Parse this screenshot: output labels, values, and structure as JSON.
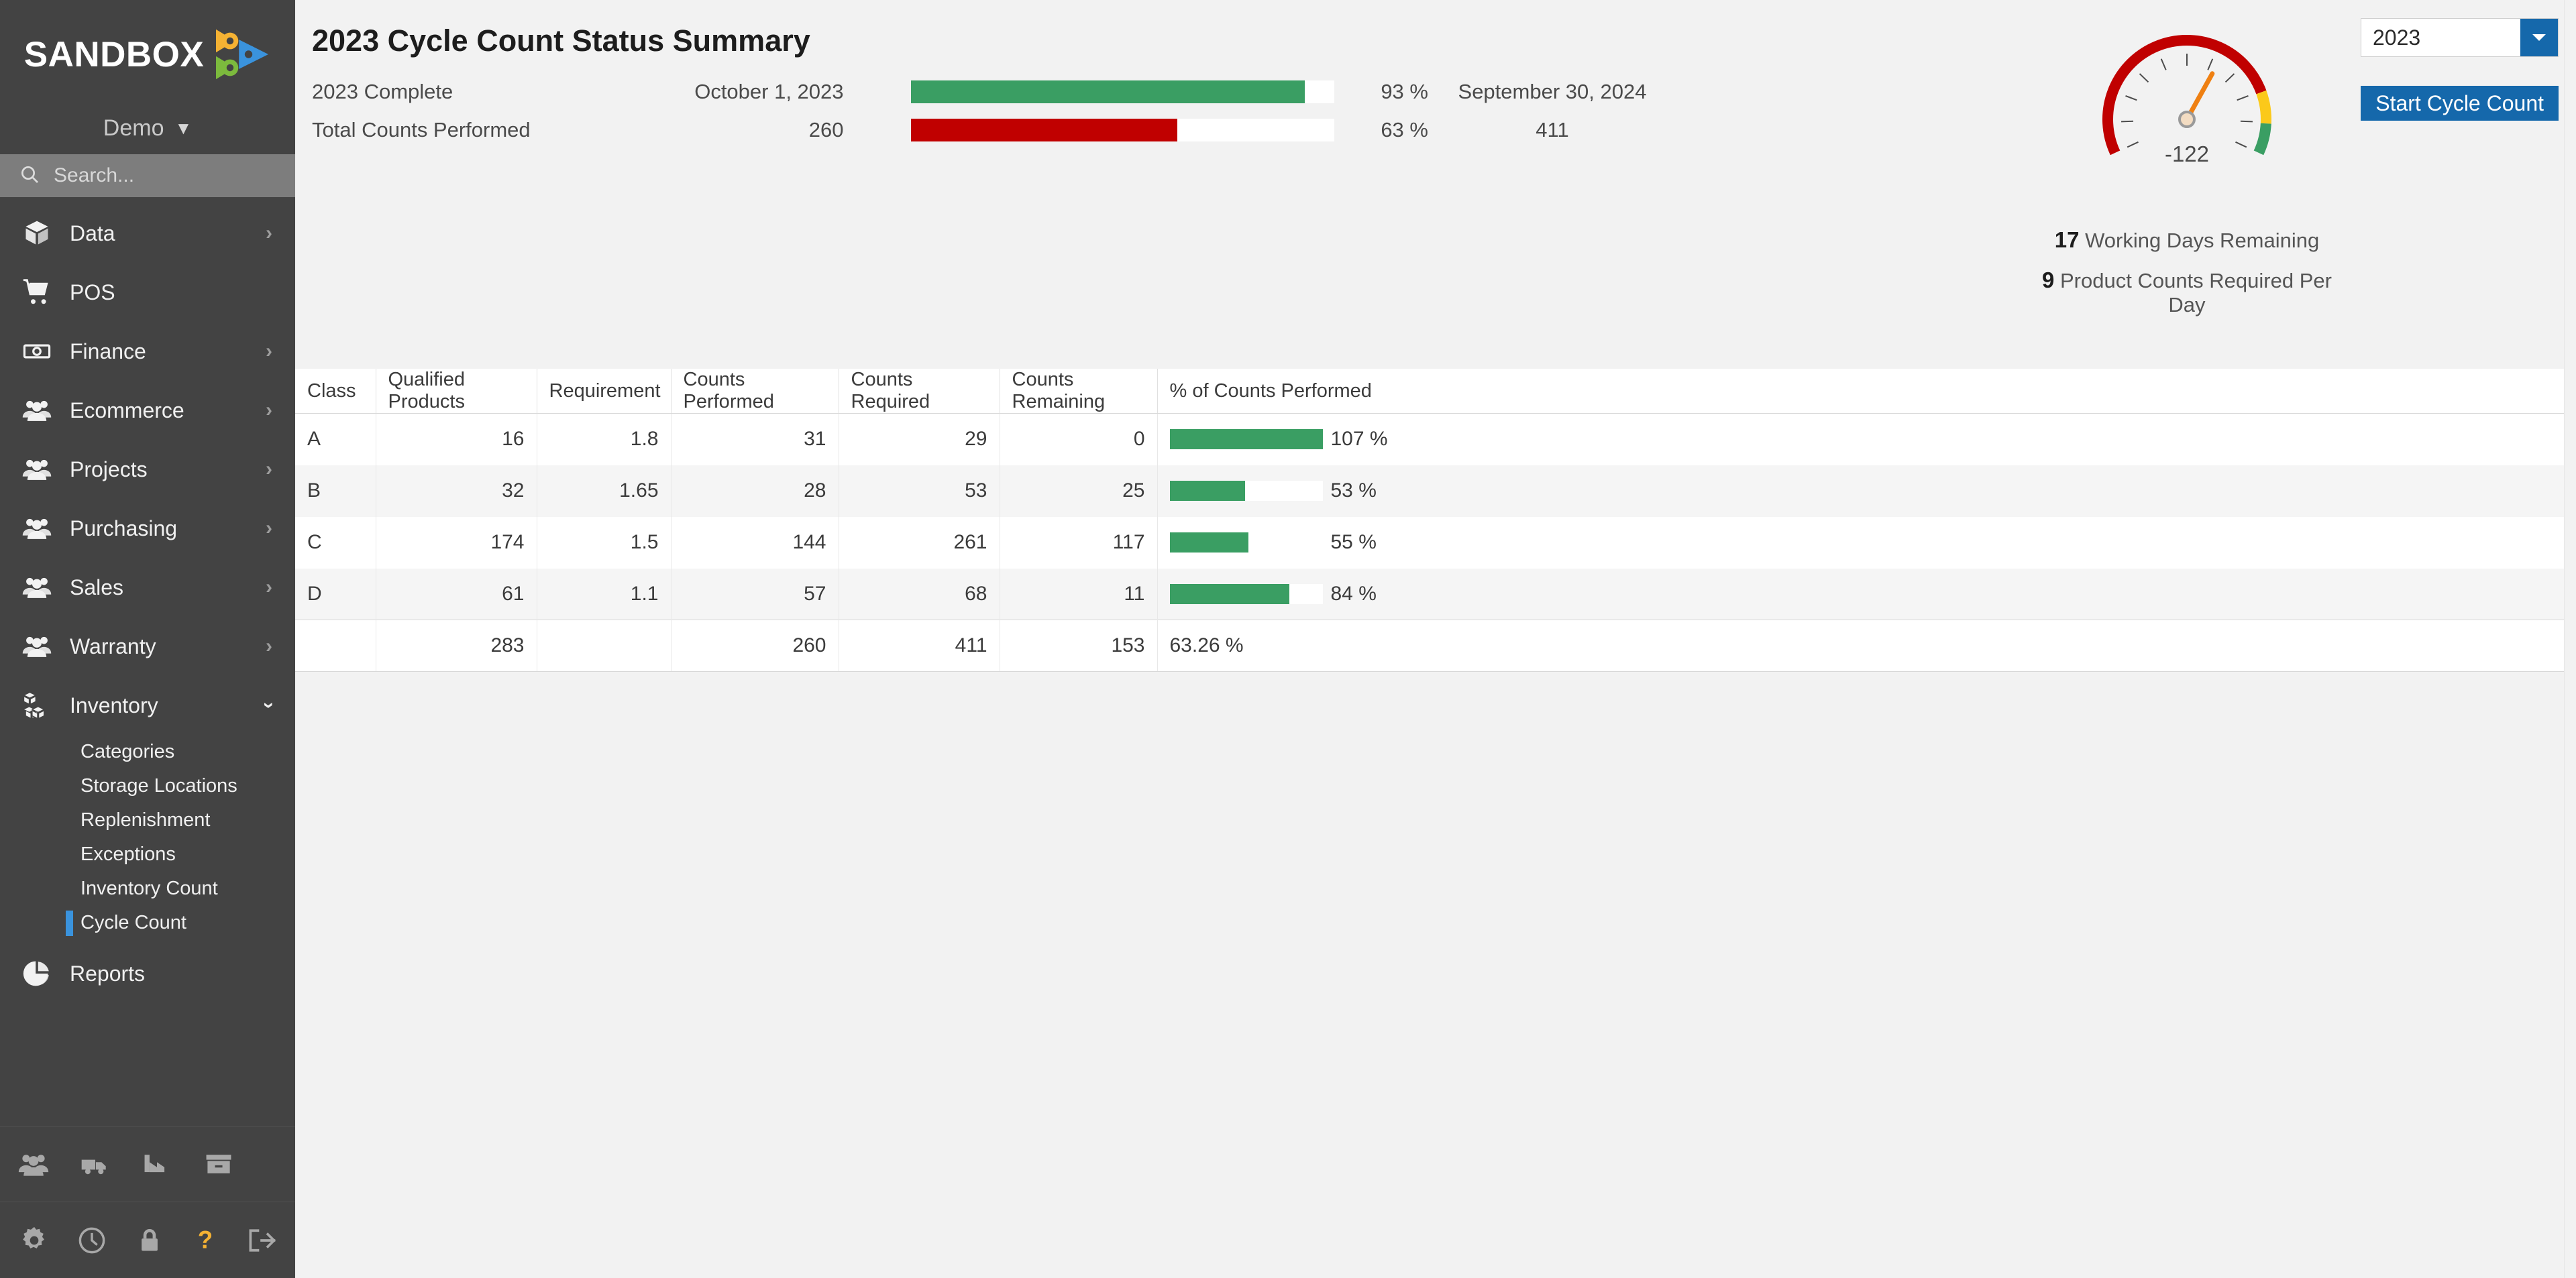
{
  "brand": {
    "name": "SANDBOX",
    "logo_icon": "sandbox-gears-play-logo",
    "tenant": "Demo",
    "tenant_chevron_icon": "chevron-down-icon"
  },
  "search": {
    "placeholder": "Search...",
    "value": "",
    "icon": "search-icon"
  },
  "sidebar": {
    "items": [
      {
        "label": "Data",
        "icon": "box-icon",
        "chevron": "chevron-right-icon",
        "expanded": false
      },
      {
        "label": "POS",
        "icon": "cart-icon",
        "chevron": "",
        "expanded": false
      },
      {
        "label": "Finance",
        "icon": "banknote-icon",
        "chevron": "chevron-right-icon",
        "expanded": false
      },
      {
        "label": "Ecommerce",
        "icon": "people-icon",
        "chevron": "chevron-right-icon",
        "expanded": false
      },
      {
        "label": "Projects",
        "icon": "people-icon",
        "chevron": "chevron-right-icon",
        "expanded": false
      },
      {
        "label": "Purchasing",
        "icon": "people-icon",
        "chevron": "chevron-right-icon",
        "expanded": false
      },
      {
        "label": "Sales",
        "icon": "people-icon",
        "chevron": "chevron-right-icon",
        "expanded": false
      },
      {
        "label": "Warranty",
        "icon": "people-icon",
        "chevron": "chevron-right-icon",
        "expanded": false
      },
      {
        "label": "Inventory",
        "icon": "boxes-icon",
        "chevron": "chevron-down-icon",
        "expanded": true
      },
      {
        "label": "Reports",
        "icon": "pie-chart-icon",
        "chevron": "",
        "expanded": false
      }
    ],
    "inventory_subitems": [
      {
        "label": "Categories",
        "active": false
      },
      {
        "label": "Storage Locations",
        "active": false
      },
      {
        "label": "Replenishment",
        "active": false
      },
      {
        "label": "Exceptions",
        "active": false
      },
      {
        "label": "Inventory Count",
        "active": false
      },
      {
        "label": "Cycle Count",
        "active": true
      }
    ],
    "bottom_icons_row1": [
      {
        "icon": "people-icon"
      },
      {
        "icon": "truck-icon"
      },
      {
        "icon": "factory-icon"
      },
      {
        "icon": "archive-box-icon"
      }
    ],
    "bottom_icons_row2": [
      {
        "icon": "gear-icon"
      },
      {
        "icon": "clock-icon"
      },
      {
        "icon": "lock-icon"
      },
      {
        "icon": "help-question-icon"
      },
      {
        "icon": "logout-icon"
      }
    ],
    "active_accent_color": "#3a93dd"
  },
  "header": {
    "title": "2023 Cycle Count Status Summary"
  },
  "toolbar": {
    "year_value": "2023",
    "year_dropdown_icon": "chevron-down-icon",
    "start_button_label": "Start Cycle Count",
    "accent_color": "#1568ab"
  },
  "summary": {
    "rows": [
      {
        "label": "2023 Complete",
        "value1": "October 1, 2023",
        "percent_label": "93 %",
        "percent": 93,
        "bar_color": "#3a9e63",
        "value2": "September 30, 2024"
      },
      {
        "label": "Total Counts Performed",
        "value1": "260",
        "percent_label": "63 %",
        "percent": 63,
        "bar_color": "#c00000",
        "value2": "411"
      }
    ]
  },
  "gauge": {
    "value_label": "-122",
    "value": -122,
    "needle_color": "#ef8012",
    "bands": [
      {
        "color": "#c00000",
        "label": "red-band"
      },
      {
        "color": "#fbc91a",
        "label": "yellow-band"
      },
      {
        "color": "#3a9e63",
        "label": "green-band"
      }
    ],
    "caption1_number": "17",
    "caption1_text": " Working Days Remaining",
    "caption2_number": "9",
    "caption2_text": " Product Counts Required Per Day"
  },
  "chart_data": {
    "type": "bar",
    "title": "% of Counts Performed by Class",
    "categories": [
      "A",
      "B",
      "C",
      "D"
    ],
    "values": [
      107,
      53,
      55,
      84
    ],
    "value_labels": [
      "107 %",
      "53 %",
      "55 %",
      "84 %"
    ],
    "xlabel": "Class",
    "ylabel": "% of Counts Performed",
    "ylim": [
      0,
      107
    ],
    "bar_color": "#3a9e63",
    "track_color": "#ffffff",
    "grid": false,
    "legend": null
  },
  "table": {
    "columns": [
      "Class",
      "Qualified Products",
      "Requirement",
      "Counts Performed",
      "Counts Required",
      "Counts Remaining",
      "% of Counts Performed"
    ],
    "rows": [
      {
        "class": "A",
        "qualified_products": "16",
        "requirement": "1.8",
        "counts_performed": "31",
        "counts_required": "29",
        "counts_remaining": "0",
        "pct_label": "107 %",
        "pct": 107,
        "show_track": true
      },
      {
        "class": "B",
        "qualified_products": "32",
        "requirement": "1.65",
        "counts_performed": "28",
        "counts_required": "53",
        "counts_remaining": "25",
        "pct_label": "53 %",
        "pct": 53,
        "show_track": true
      },
      {
        "class": "C",
        "qualified_products": "174",
        "requirement": "1.5",
        "counts_performed": "144",
        "counts_required": "261",
        "counts_remaining": "117",
        "pct_label": "55 %",
        "pct": 55,
        "show_track": false
      },
      {
        "class": "D",
        "qualified_products": "61",
        "requirement": "1.1",
        "counts_performed": "57",
        "counts_required": "68",
        "counts_remaining": "11",
        "pct_label": "84 %",
        "pct": 84,
        "show_track": true
      }
    ],
    "total_row": {
      "class": "",
      "qualified_products": "283",
      "requirement": "",
      "counts_performed": "260",
      "counts_required": "411",
      "counts_remaining": "153",
      "pct_label": "63.26 %"
    },
    "scrollbar": {
      "up_icon": "scroll-up-icon",
      "down_icon": "scroll-down-icon"
    }
  }
}
